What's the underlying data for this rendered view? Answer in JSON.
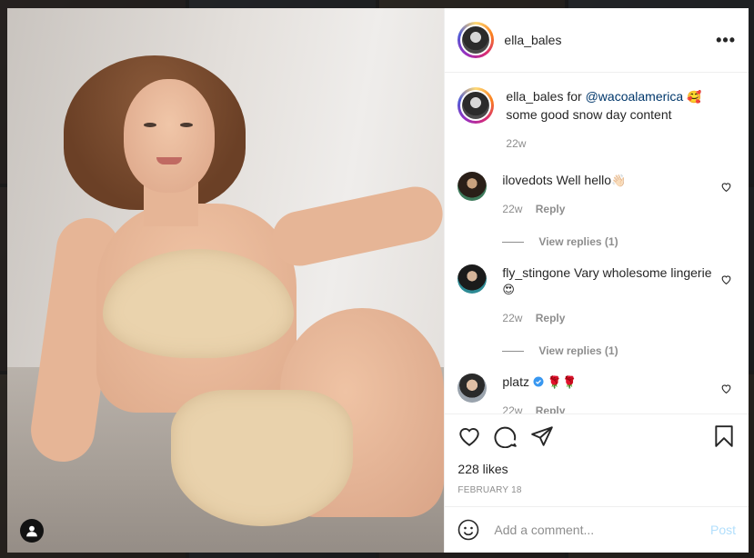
{
  "post": {
    "username": "ella_bales",
    "menu_icon": "more-horizontal-icon"
  },
  "caption": {
    "username": "ella_bales",
    "for_word": "for",
    "mention": "@wacoalamerica",
    "emoji": "🥰",
    "text_line2": "some good snow day content",
    "time": "22w"
  },
  "comments": [
    {
      "username": "ilovedots",
      "text": "Well hello",
      "emoji": "👋🏻",
      "time": "22w",
      "reply_label": "Reply",
      "view_replies": "View replies (1)"
    },
    {
      "username": "fly_stingone",
      "text": "Vary wholesome lingerie",
      "emoji": "😍",
      "time": "22w",
      "reply_label": "Reply",
      "view_replies": "View replies (1)"
    },
    {
      "username": "platz",
      "verified": true,
      "text": "",
      "emoji": "🌹🌹",
      "time": "22w",
      "reply_label": "Reply"
    }
  ],
  "stats": {
    "likes": "228 likes",
    "date": "FEBRUARY 18"
  },
  "comment_box": {
    "placeholder": "Add a comment...",
    "post_label": "Post"
  },
  "colors": {
    "link": "#00376b",
    "muted": "#8e8e8e",
    "post_disabled": "#b2dffc"
  }
}
